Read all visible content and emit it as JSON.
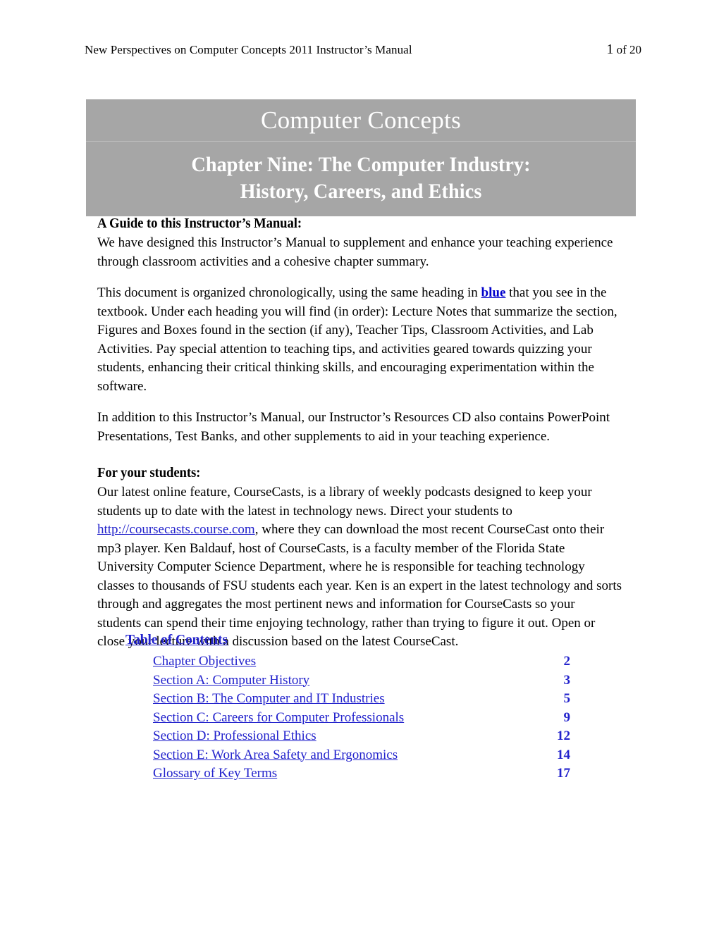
{
  "header": {
    "left_text": "New Perspectives on Computer Concepts 2011 Instructor’s Manual",
    "page_current": "1",
    "page_of": " of 20"
  },
  "banner": {
    "title": "Computer Concepts",
    "subtitle_line1": "Chapter Nine: The Computer Industry:",
    "subtitle_line2": "History, Careers, and Ethics",
    "background_color": "#a6a6a6",
    "text_color": "#ffffff"
  },
  "guide_section": {
    "heading": "A Guide to this Instructor’s Manual:",
    "paragraph1": "We have designed this Instructor’s Manual to supplement and enhance your teaching experience through classroom activities and a cohesive chapter summary.",
    "paragraph2_part1": "This document is organized chronologically, using the same heading in ",
    "paragraph2_keyword": "blue",
    "paragraph2_part2": " that you see in the textbook. Under each heading you will find (in order): Lecture Notes that summarize the section, Figures and Boxes found in the section (if any), Teacher Tips, Classroom Activities, and Lab Activities. Pay special attention to teaching tips, and activities geared towards quizzing your students, enhancing their critical thinking skills, and encouraging experimentation within the software.",
    "paragraph3": "In addition to this Instructor’s Manual, our Instructor’s Resources CD also contains PowerPoint Presentations, Test Banks, and other supplements to aid in your teaching experience."
  },
  "students_section": {
    "heading": "For your students:",
    "paragraph_part1": "Our latest online feature, CourseCasts, is a library of weekly podcasts designed to keep your students up to date with the latest in technology news. Direct your students to ",
    "link_text": "http://coursecasts.course.com",
    "paragraph_part2": ", where they can download the most recent CourseCast onto their mp3 player. Ken Baldauf, host of CourseCasts, is a faculty member of the Florida State University Computer Science Department, where he is responsible for teaching technology classes to thousands of FSU students each year. Ken is an expert in the latest technology and sorts through and aggregates the most pertinent news and information for CourseCasts so your students can spend their time enjoying technology, rather than trying to figure it out. Open or close your lecture with a discussion based on the latest CourseCast."
  },
  "table_of_contents": {
    "title": "Table of Contents ",
    "link_color": "#2222cc",
    "entries": [
      {
        "label": "Chapter Objectives",
        "page": "2"
      },
      {
        "label": "Section A: Computer History",
        "page": "3"
      },
      {
        "label": "Section B: The Computer and IT Industries",
        "page": "5"
      },
      {
        "label": "Section C: Careers for Computer Professionals",
        "page": "9"
      },
      {
        "label": "Section D: Professional Ethics",
        "page": "12"
      },
      {
        "label": "Section E: Work Area Safety and Ergonomics",
        "page": "14"
      },
      {
        "label": "Glossary of Key Terms",
        "page": "17"
      }
    ]
  }
}
